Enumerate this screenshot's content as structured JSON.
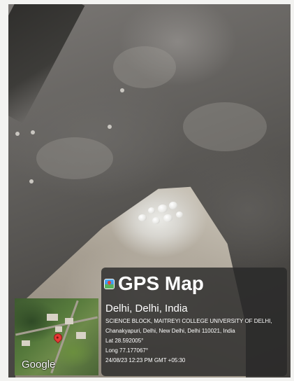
{
  "overlay": {
    "app_icon": "map-pin-icon",
    "app_title": "GPS Map",
    "place": "Delhi, Delhi, India",
    "address_line1": "SCIENCE BLOCK, MAITREYI COLLEGE UNIVERSITY OF DELHI,",
    "address_line2": "Chanakyapuri, Delhi, New Delhi, Delhi 110021, India",
    "latitude": "Lat 28.592005°",
    "longitude": "Long 77.177067°",
    "timestamp": "24/08/23 12:23 PM GMT +05:30"
  },
  "map": {
    "attribution": "Google",
    "pin_color": "#e53935"
  }
}
